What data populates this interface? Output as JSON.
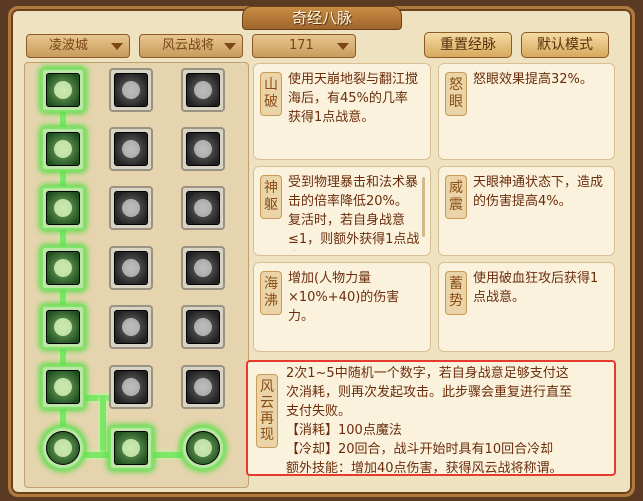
{
  "title": "奇经八脉",
  "dropdowns": {
    "server": "凌波城",
    "school": "风云战将",
    "level": "171"
  },
  "buttons": {
    "reset": "重置经脉",
    "default_mode": "默认模式"
  },
  "cards": [
    {
      "label": "山破",
      "text": "使用天崩地裂与翻江搅海后，有45%的几率获得1点战意。"
    },
    {
      "label": "怒眼",
      "text": "怒眼效果提高32%。"
    },
    {
      "label": "神躯",
      "text": "受到物理暴击和法术暴击的倍率降低20%。复活时，若自身战意≤1，则额外获得1点战意。"
    },
    {
      "label": "威震",
      "text": "天眼神通状态下，造成的伤害提高4%。"
    },
    {
      "label": "海沸",
      "text": "增加(人物力量×10%+40)的伤害力。"
    },
    {
      "label": "蓄势",
      "text": "使用破血狂攻后获得1点战意。"
    }
  ],
  "big_card": {
    "label": "风云再现",
    "lines": [
      "2次1~5中随机一个数字，若自身战意足够支付这",
      "次消耗，则再次发起攻击。此步骤会重复进行直至",
      "支付失败。",
      "【消耗】100点魔法",
      "【冷却】20回合，战斗开始时具有10回合冷却",
      "额外技能：增加40点伤害，获得风云战将称谓。"
    ]
  },
  "nodes": [
    {
      "name": "node-r1-c1",
      "icon": "mountain-icon",
      "active": true
    },
    {
      "name": "node-r1-c2",
      "icon": "flag-icon",
      "active": false
    },
    {
      "name": "node-r1-c3",
      "icon": "swirl-icon",
      "active": false
    },
    {
      "name": "node-r2-c1",
      "icon": "wave-icon",
      "active": true
    },
    {
      "name": "node-r2-c2",
      "icon": "figure-icon",
      "active": false
    },
    {
      "name": "node-r2-c3",
      "icon": "drops-icon",
      "active": false
    },
    {
      "name": "node-r3-c1",
      "icon": "strongman-icon",
      "active": true
    },
    {
      "name": "node-r3-c2",
      "icon": "fist-icon",
      "active": false
    },
    {
      "name": "node-r3-c3",
      "icon": "octopus-icon",
      "active": false
    },
    {
      "name": "node-r4-c1",
      "icon": "cliff-icon",
      "active": true
    },
    {
      "name": "node-r4-c2",
      "icon": "torches-icon",
      "active": false
    },
    {
      "name": "node-r4-c3",
      "icon": "eye-icon",
      "active": false
    },
    {
      "name": "node-r5-c1",
      "icon": "sea-icon",
      "active": true
    },
    {
      "name": "node-r5-c2",
      "icon": "shatter-icon",
      "active": false
    },
    {
      "name": "node-r5-c3",
      "icon": "robe-icon",
      "active": false
    },
    {
      "name": "node-r6-c1",
      "icon": "cloud-icon",
      "active": true
    },
    {
      "name": "node-r6-c2",
      "icon": "octagon-icon",
      "active": false
    },
    {
      "name": "node-r6-c3",
      "icon": "meditate-icon",
      "active": false
    },
    {
      "name": "node-r7-c1",
      "icon": "ring-icon",
      "active": true
    },
    {
      "name": "node-r7-c2",
      "icon": "dragon-icon",
      "active": true
    },
    {
      "name": "node-r7-c3",
      "icon": "coil-icon",
      "active": true
    }
  ]
}
